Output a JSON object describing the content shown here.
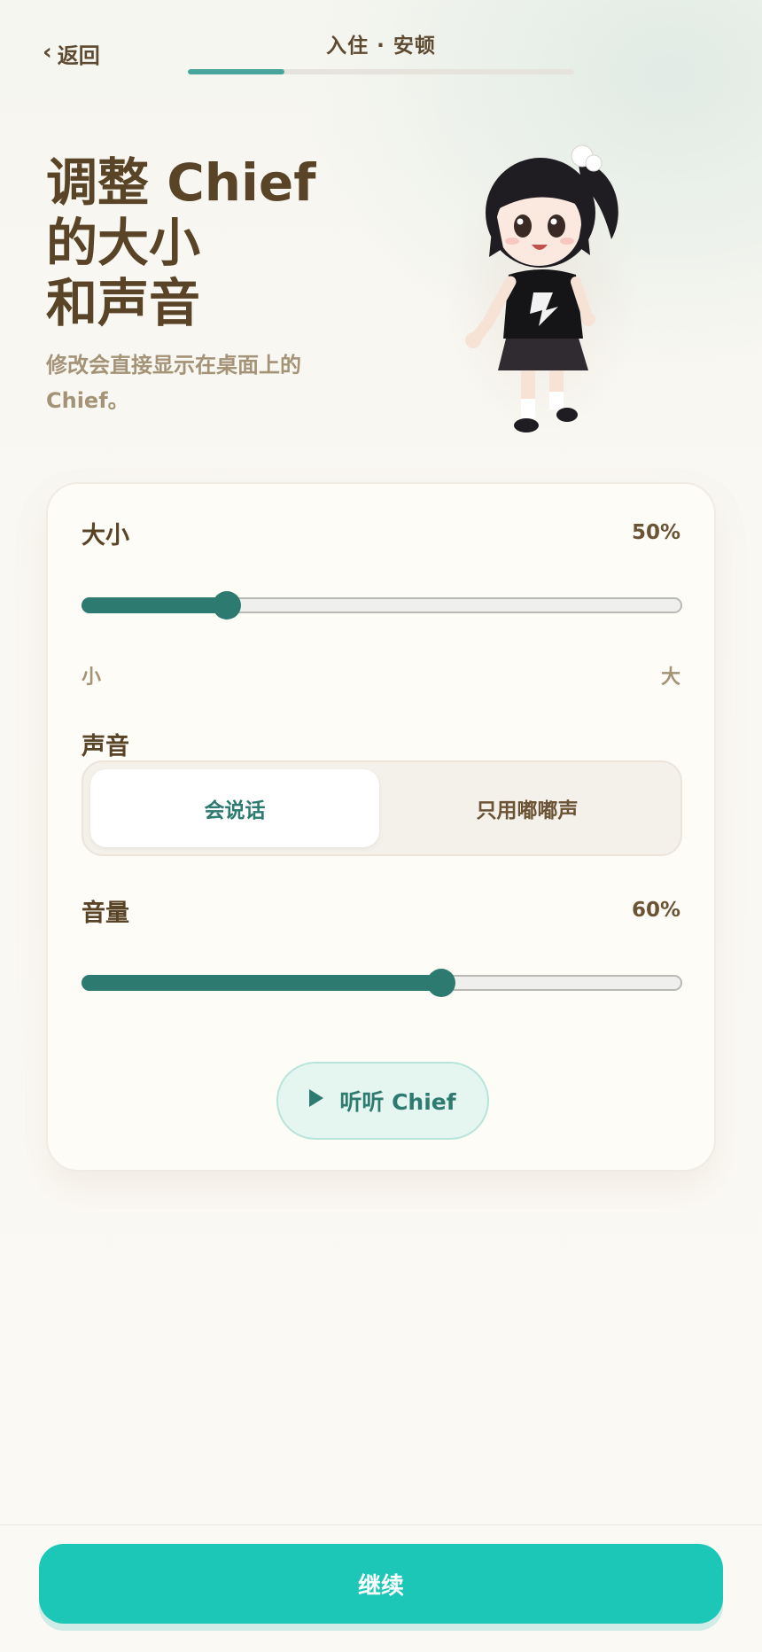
{
  "header": {
    "back_label": "返回",
    "step_title": "入住 · 安顿",
    "progress": 0.25
  },
  "hero": {
    "title_line1": "调整 Chief",
    "title_line2": "的大小",
    "title_line3": "和声音",
    "subtitle": "修改会直接显示在桌面上的 Chief。"
  },
  "settings": {
    "size": {
      "label": "大小",
      "value_text": "50%",
      "position": 0.24,
      "min_label": "小",
      "max_label": "大"
    },
    "voice": {
      "label": "声音",
      "options": [
        "会说话",
        "只用嘟嘟声"
      ],
      "selected": "会说话"
    },
    "volume": {
      "label": "音量",
      "value_text": "60%",
      "position": 0.6
    },
    "listen_label": "听听 Chief"
  },
  "footer": {
    "continue_label": "继续"
  },
  "colors": {
    "accent": "#2d7a70",
    "primary_button": "#1dc7b8",
    "text": "#5a4427"
  }
}
